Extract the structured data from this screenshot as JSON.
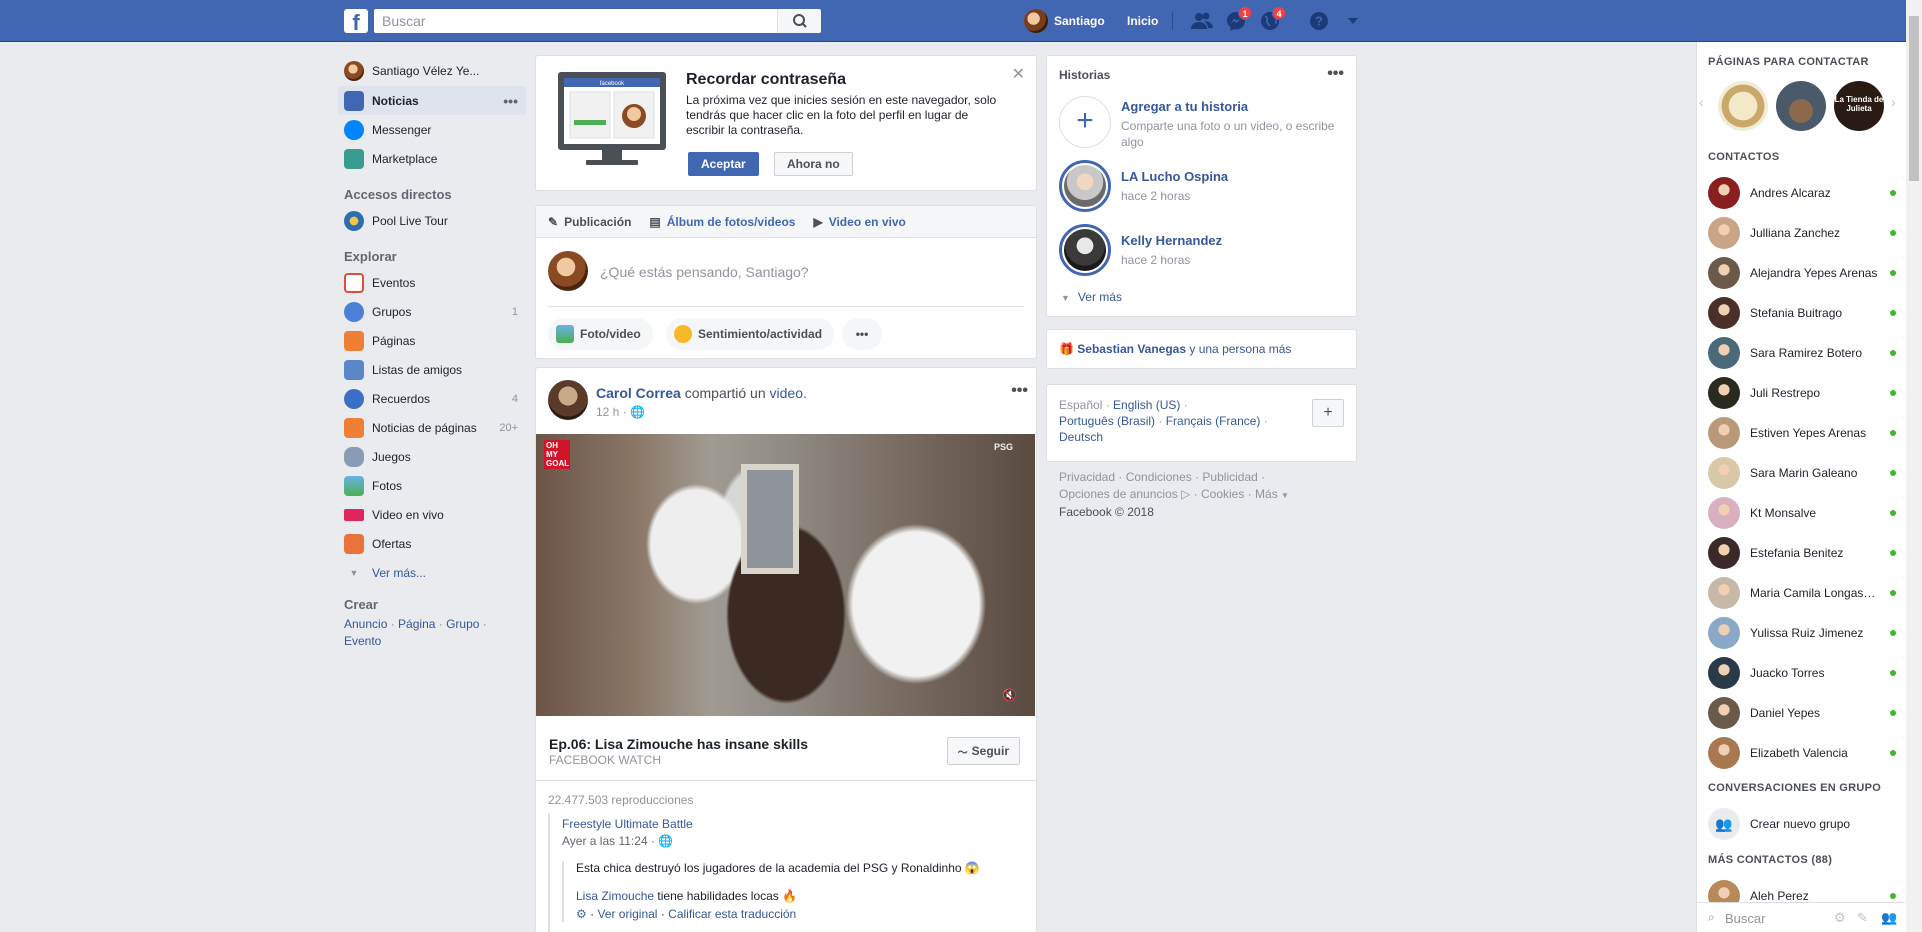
{
  "topbar": {
    "search_placeholder": "Buscar",
    "user_name": "Santiago",
    "home_label": "Inicio",
    "messages_badge": "1",
    "notifications_badge": "4"
  },
  "leftnav": {
    "profile_name": "Santiago Vélez Ye...",
    "items": [
      {
        "label": "Noticias"
      },
      {
        "label": "Messenger"
      },
      {
        "label": "Marketplace"
      }
    ],
    "shortcuts_header": "Accesos directos",
    "shortcuts": [
      {
        "label": "Pool Live Tour"
      }
    ],
    "explore_header": "Explorar",
    "explore": [
      {
        "label": "Eventos",
        "count": ""
      },
      {
        "label": "Grupos",
        "count": "1"
      },
      {
        "label": "Páginas",
        "count": ""
      },
      {
        "label": "Listas de amigos",
        "count": ""
      },
      {
        "label": "Recuerdos",
        "count": "4"
      },
      {
        "label": "Noticias de páginas",
        "count": "20+"
      },
      {
        "label": "Juegos",
        "count": ""
      },
      {
        "label": "Fotos",
        "count": ""
      },
      {
        "label": "Video en vivo",
        "count": ""
      },
      {
        "label": "Ofertas",
        "count": ""
      }
    ],
    "see_more": "Ver más...",
    "create_header": "Crear",
    "create_links": [
      "Anuncio",
      "Página",
      "Grupo",
      "Evento"
    ]
  },
  "remember": {
    "title": "Recordar contraseña",
    "text": "La próxima vez que inicies sesión en este navegador, solo tendrás que hacer clic en la foto del perfil en lugar de escribir la contraseña.",
    "accept": "Aceptar",
    "later": "Ahora no",
    "laptop_brand": "facebook"
  },
  "composer": {
    "tabs": [
      "Publicación",
      "Álbum de fotos/videos",
      "Video en vivo"
    ],
    "placeholder": "¿Qué estás pensando, Santiago?",
    "actions": [
      "Foto/video",
      "Sentimiento/actividad"
    ]
  },
  "post": {
    "author": "Carol Correa",
    "action": "compartió un",
    "object": "video.",
    "time": "12 h",
    "video_overlay": "OH MY GOAL",
    "video_channel": "PSG",
    "video_title": "Ep.06: Lisa Zimouche has insane skills",
    "video_source": "FACEBOOK WATCH",
    "follow_label": "Seguir",
    "views": "22.477.503 reproducciones",
    "shared_page": "Freestyle Ultimate Battle",
    "shared_time": "Ayer a las 11:24",
    "shared_text1": "Esta chica destruyó los jugadores de la academia del PSG y Ronaldinho 😱",
    "shared_mention": "Lisa Zimouche",
    "shared_text2": "tiene habilidades locas 🔥",
    "see_original": "Ver original",
    "rate_translation": "Calificar esta traducción"
  },
  "stories": {
    "header": "Historias",
    "add_title": "Agregar a tu historia",
    "add_sub": "Comparte una foto o un video, o escribe algo",
    "items": [
      {
        "name": "LA Lucho Ospina",
        "time": "hace 2 horas"
      },
      {
        "name": "Kelly Hernandez",
        "time": "hace 2 horas"
      }
    ],
    "see_more": "Ver más"
  },
  "birthday": {
    "name": "Sebastian Vanegas",
    "rest": "y una persona más"
  },
  "languages": {
    "current": "Español",
    "others": [
      "English (US)",
      "Português (Brasil)",
      "Français (France)",
      "Deutsch"
    ]
  },
  "footer": {
    "links": [
      "Privacidad",
      "Condiciones",
      "Publicidad",
      "Opciones de anuncios",
      "Cookies",
      "Más"
    ],
    "copyright": "Facebook © 2018"
  },
  "chat": {
    "pages_header": "PÁGINAS PARA CONTACTAR",
    "page_label": "La Tienda de Julieta",
    "contacts_header": "CONTACTOS",
    "contacts": [
      {
        "name": "Andres Alcaraz",
        "color": "#8a1f1f"
      },
      {
        "name": "Julliana Zanchez",
        "color": "#c9a487"
      },
      {
        "name": "Alejandra Yepes Arenas",
        "color": "#6b5a4a"
      },
      {
        "name": "Stefania Buitrago",
        "color": "#4a3028"
      },
      {
        "name": "Sara Ramirez Botero",
        "color": "#4a6a7a"
      },
      {
        "name": "Juli Restrepo",
        "color": "#2a2a20"
      },
      {
        "name": "Estiven Yepes Arenas",
        "color": "#b89a7a"
      },
      {
        "name": "Sara Marin Galeano",
        "color": "#d8c8a8"
      },
      {
        "name": "Kt Monsalve",
        "color": "#d8b0c0"
      },
      {
        "name": "Estefania Benitez",
        "color": "#3a2a2a"
      },
      {
        "name": "Maria Camila Longas Alvarez",
        "color": "#c8b8a8"
      },
      {
        "name": "Yulissa Ruiz Jimenez",
        "color": "#8aa8c8"
      },
      {
        "name": "Juacko Torres",
        "color": "#2a3a48"
      },
      {
        "name": "Daniel Yepes",
        "color": "#6a5a4a"
      },
      {
        "name": "Elizabeth Valencia",
        "color": "#a87850"
      }
    ],
    "groups_header": "CONVERSACIONES EN GRUPO",
    "create_group": "Crear nuevo grupo",
    "more_header": "MÁS CONTACTOS (88)",
    "more_contacts": [
      {
        "name": "Aleh Perez",
        "color": "#b88a5a"
      }
    ],
    "search_placeholder": "Buscar"
  }
}
